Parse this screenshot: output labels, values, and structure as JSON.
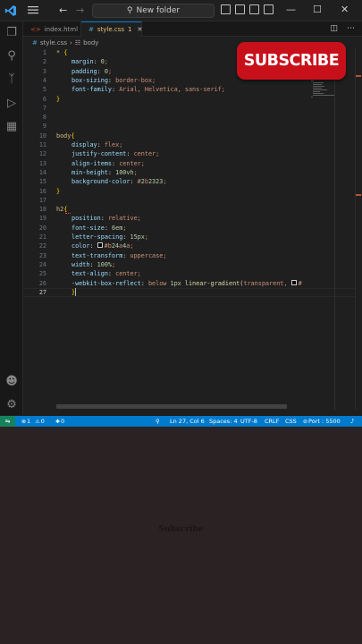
{
  "titlebar": {
    "search_text": "New folder"
  },
  "tabs": [
    {
      "label": "index.html",
      "icon": "<>",
      "active": false
    },
    {
      "label": "style.css",
      "icon": "#",
      "active": true,
      "badge": "1"
    }
  ],
  "breadcrumb": {
    "file": "style.css",
    "symbol": "body"
  },
  "editor": {
    "current_line": 27,
    "lines": [
      {
        "n": "1",
        "text": "* {"
      },
      {
        "n": "2",
        "text": "margin: 0;"
      },
      {
        "n": "3",
        "text": "padding: 0;"
      },
      {
        "n": "4",
        "text": "box-sizing: border-box;"
      },
      {
        "n": "5",
        "text": "font-family: Arial, Helvetica, sans-serif;"
      },
      {
        "n": "6",
        "text": "}"
      },
      {
        "n": "7",
        "text": ""
      },
      {
        "n": "8",
        "text": ""
      },
      {
        "n": "9",
        "text": ""
      },
      {
        "n": "10",
        "text": "body{"
      },
      {
        "n": "11",
        "text": "display: flex;"
      },
      {
        "n": "12",
        "text": "justify-content: center;"
      },
      {
        "n": "13",
        "text": "align-items: center;"
      },
      {
        "n": "14",
        "text": "min-height: 100vh;"
      },
      {
        "n": "15",
        "text": "background-color: #2b2323;"
      },
      {
        "n": "16",
        "text": "}"
      },
      {
        "n": "17",
        "text": ""
      },
      {
        "n": "18",
        "text": "h2{"
      },
      {
        "n": "19",
        "text": "position: relative;"
      },
      {
        "n": "20",
        "text": "font-size: 6em;"
      },
      {
        "n": "21",
        "text": "letter-spacing: 15px;"
      },
      {
        "n": "22",
        "text": "color: #b24a4a;"
      },
      {
        "n": "23",
        "text": "text-transform: uppercase;"
      },
      {
        "n": "24",
        "text": "width: 100%;"
      },
      {
        "n": "25",
        "text": "text-align: center;"
      },
      {
        "n": "26",
        "text": "-webkit-box-reflect: below 1px linear-gradient(transparent, #"
      },
      {
        "n": "27",
        "text": "}"
      }
    ],
    "swatch_colors": {
      "bg": "#2b2323",
      "h2": "#b24a4a",
      "grad": "#000000"
    }
  },
  "overlay": {
    "subscribe_label": "SUBSCRIBE",
    "color": "#c8101b"
  },
  "statusbar": {
    "errors": "1",
    "warnings": "0",
    "remote": "0",
    "position": "Ln 27, Col 6",
    "spaces": "Spaces: 4",
    "encoding": "UTF-8",
    "eol": "CRLF",
    "language": "CSS",
    "port": "Port : 5500"
  },
  "preview": {
    "background": "#2b2323",
    "heading": "Subscribe"
  }
}
